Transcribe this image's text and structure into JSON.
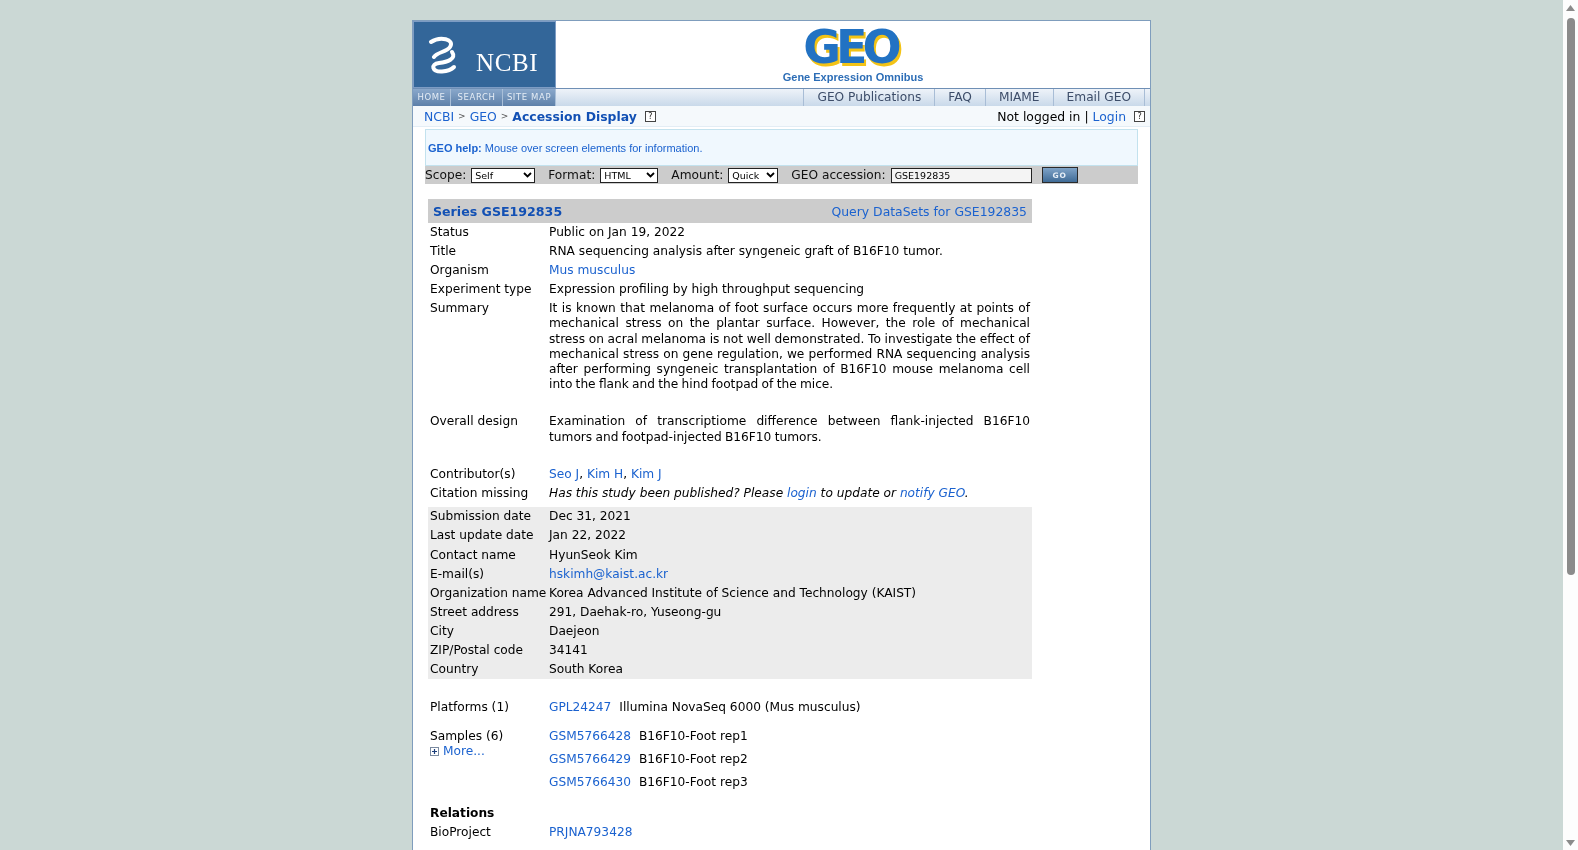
{
  "header": {
    "ncbi_logo": "NCBI",
    "geo_logo": "GEO",
    "geo_subtitle": "Gene Expression Omnibus"
  },
  "nav": {
    "site_links": [
      "HOME",
      "SEARCH",
      "SITE MAP"
    ],
    "geo_links": [
      "GEO Publications",
      "FAQ",
      "MIAME",
      "Email GEO"
    ]
  },
  "breadcrumb": {
    "items": [
      {
        "kind": "link",
        "text": "NCBI"
      },
      {
        "kind": "separator",
        "text": ">"
      },
      {
        "kind": "link",
        "text": "GEO"
      },
      {
        "kind": "separator",
        "text": ">"
      },
      {
        "kind": "current",
        "text": "Accession Display"
      }
    ],
    "help": "?"
  },
  "account": {
    "items": [
      {
        "kind": "text",
        "text": "Not logged in"
      },
      {
        "kind": "separator",
        "text": "|"
      },
      {
        "kind": "link",
        "text": "Login"
      }
    ],
    "help": "?"
  },
  "help_box": {
    "text": "**GEO help:** Mouse over screen elements for information."
  },
  "query_bar": {
    "fields": [
      {
        "kind": "select",
        "label": "Scope:",
        "value": "Self"
      },
      {
        "kind": "select",
        "label": "Format:",
        "value": "HTML"
      },
      {
        "kind": "select",
        "label": "Amount:",
        "value": "Quick"
      },
      {
        "kind": "input",
        "label": "GEO accession:",
        "value": "GSE192835"
      }
    ],
    "button": "GO"
  },
  "series": {
    "title": "Series GSE192835",
    "query_link": "Query DataSets for GSE192835",
    "sections": [
      {
        "shaded": false,
        "rows": [
          {
            "label": "Status",
            "kind": "text",
            "value": "Public on Jan 19, 2022"
          },
          {
            "label": "Title",
            "kind": "text",
            "value": "RNA sequencing analysis after syngeneic graft of B16F10 tumor."
          },
          {
            "label": "Organism",
            "kind": "link",
            "value": "Mus musculus"
          },
          {
            "label": "Experiment type",
            "kind": "text",
            "value": "Expression profiling by high throughput sequencing"
          },
          {
            "label": "Summary",
            "kind": "paragraph",
            "value": "It is known that melanoma of foot surface occurs more frequently at points of mechanical stress on the plantar surface. However, the role of mechanical stress on acral melanoma is not well demonstrated. To investigate the effect of mechanical stress on gene regulation, we performed RNA sequencing analysis after performing syngeneic transplantation of B16F10 mouse melanoma cell into the flank and the hind footpad of the mice."
          },
          {
            "label": "Overall design",
            "kind": "paragraph",
            "value": "Examination of transcriptiome difference between flank-injected B16F10 tumors and footpad-injected B16F10 tumors."
          }
        ]
      },
      {
        "shaded": false,
        "rows": [
          {
            "label": "Contributor(s)",
            "kind": "parts",
            "parts": [
              {
                "text": "Seo J",
                "link": true
              },
              {
                "text": ", ",
                "link": false
              },
              {
                "text": "Kim H",
                "link": true
              },
              {
                "text": ", ",
                "link": false
              },
              {
                "text": "Kim J",
                "link": true
              }
            ]
          },
          {
            "label": "Citation missing",
            "kind": "note",
            "parts": [
              {
                "text": "Has this study been published? Please ",
                "link": false
              },
              {
                "text": "login",
                "link": true
              },
              {
                "text": " to update or ",
                "link": false
              },
              {
                "text": "notify GEO",
                "link": true
              },
              {
                "text": ".",
                "link": false
              }
            ]
          }
        ]
      },
      {
        "shaded": true,
        "rows": [
          {
            "label": "Submission date",
            "kind": "text",
            "value": "Dec 31, 2021"
          },
          {
            "label": "Last update date",
            "kind": "text",
            "value": "Jan 22, 2022"
          },
          {
            "label": "Contact name",
            "kind": "text",
            "value": "HyunSeok Kim"
          },
          {
            "label": "E-mail(s)",
            "kind": "link",
            "value": "hskimh@kaist.ac.kr"
          },
          {
            "label": "Organization name",
            "kind": "text",
            "value": "Korea Advanced Institute of Science and Technology (KAIST)"
          },
          {
            "label": "Street address",
            "kind": "text",
            "value": "291, Daehak-ro, Yuseong-gu"
          },
          {
            "label": "City",
            "kind": "text",
            "value": "Daejeon"
          },
          {
            "label": "ZIP/Postal code",
            "kind": "text",
            "value": "34141"
          },
          {
            "label": "Country",
            "kind": "text",
            "value": "South Korea"
          }
        ]
      },
      {
        "shaded": false,
        "rows": [
          {
            "label": "Platforms (1)",
            "kind": "records",
            "records": [
              {
                "id": "GPL24247",
                "title": "Illumina NovaSeq 6000 (Mus musculus)"
              }
            ]
          },
          {
            "label": "Samples (6)",
            "kind": "records",
            "more": "More...",
            "records": [
              {
                "id": "GSM5766428",
                "title": "B16F10-Foot rep1"
              },
              {
                "id": "GSM5766429",
                "title": "B16F10-Foot rep2"
              },
              {
                "id": "GSM5766430",
                "title": "B16F10-Foot rep3"
              }
            ]
          }
        ]
      },
      {
        "shaded": false,
        "heading": "Relations",
        "rows": [
          {
            "label": "BioProject",
            "kind": "link",
            "value": "PRJNA793428"
          }
        ]
      }
    ]
  }
}
